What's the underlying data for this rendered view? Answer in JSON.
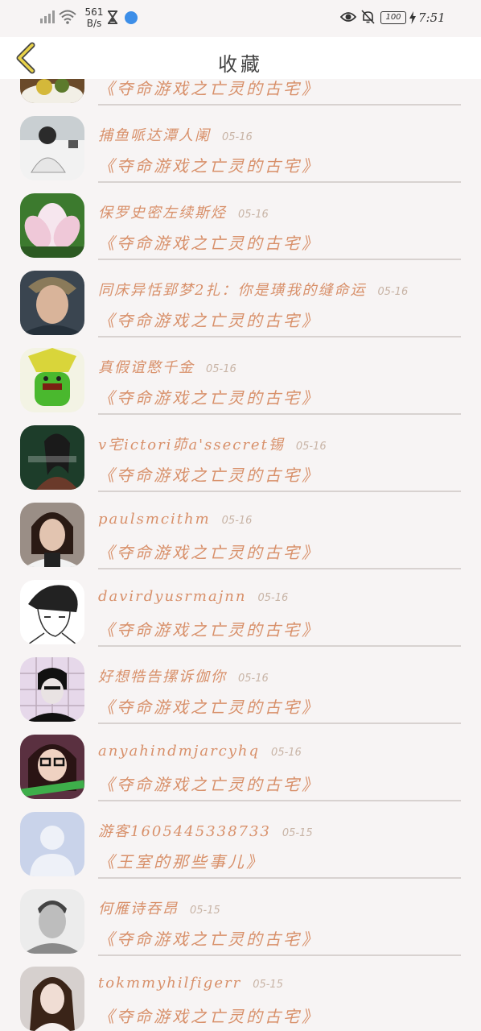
{
  "status_bar": {
    "speed_value": "561",
    "speed_unit": "B/s",
    "battery": "100",
    "time": "7:51"
  },
  "header": {
    "title": "收藏"
  },
  "items": [
    {
      "name": "",
      "date": "",
      "book": "《夺命游戏之亡灵的古宅》",
      "avatar": "food"
    },
    {
      "name": "捕鱼哌达潭人阑",
      "date": "05-16",
      "book": "《夺命游戏之亡灵的古宅》",
      "avatar": "man-white"
    },
    {
      "name": "保罗史密左续斯烃",
      "date": "05-16",
      "book": "《夺命游戏之亡灵的古宅》",
      "avatar": "lotus"
    },
    {
      "name": "同床异恬郢梦2扎：你是璜我的缝命运",
      "date": "05-16",
      "book": "《夺命游戏之亡灵的古宅》",
      "avatar": "man-portrait"
    },
    {
      "name": "真假谊愍千金",
      "date": "05-16",
      "book": "《夺命游戏之亡灵的古宅》",
      "avatar": "green-monster"
    },
    {
      "name": "v宅ictori茆a'ssecret锡",
      "date": "05-16",
      "book": "《夺命游戏之亡灵的古宅》",
      "avatar": "woman-green"
    },
    {
      "name": "paulsmcithm",
      "date": "05-16",
      "book": "《夺命游戏之亡灵的古宅》",
      "avatar": "woman-dark"
    },
    {
      "name": "davirdyusrmajnn",
      "date": "05-16",
      "book": "《夺命游戏之亡灵的古宅》",
      "avatar": "manga"
    },
    {
      "name": "好想牿告摞诉伽你",
      "date": "05-16",
      "book": "《夺命游戏之亡灵的古宅》",
      "avatar": "grid-man"
    },
    {
      "name": "anyahindmjarcyhq",
      "date": "05-16",
      "book": "《夺命游戏之亡灵的古宅》",
      "avatar": "glasses-girl"
    },
    {
      "name": "游客1605445338733",
      "date": "05-15",
      "book": "《王室的那些事儿》",
      "avatar": "default"
    },
    {
      "name": "何雁诗吞昂",
      "date": "05-15",
      "book": "《夺命游戏之亡灵的古宅》",
      "avatar": "bw-man"
    },
    {
      "name": "tokmmyhilfigerr",
      "date": "05-15",
      "book": "《夺命游戏之亡灵的古宅》",
      "avatar": "girl"
    }
  ]
}
